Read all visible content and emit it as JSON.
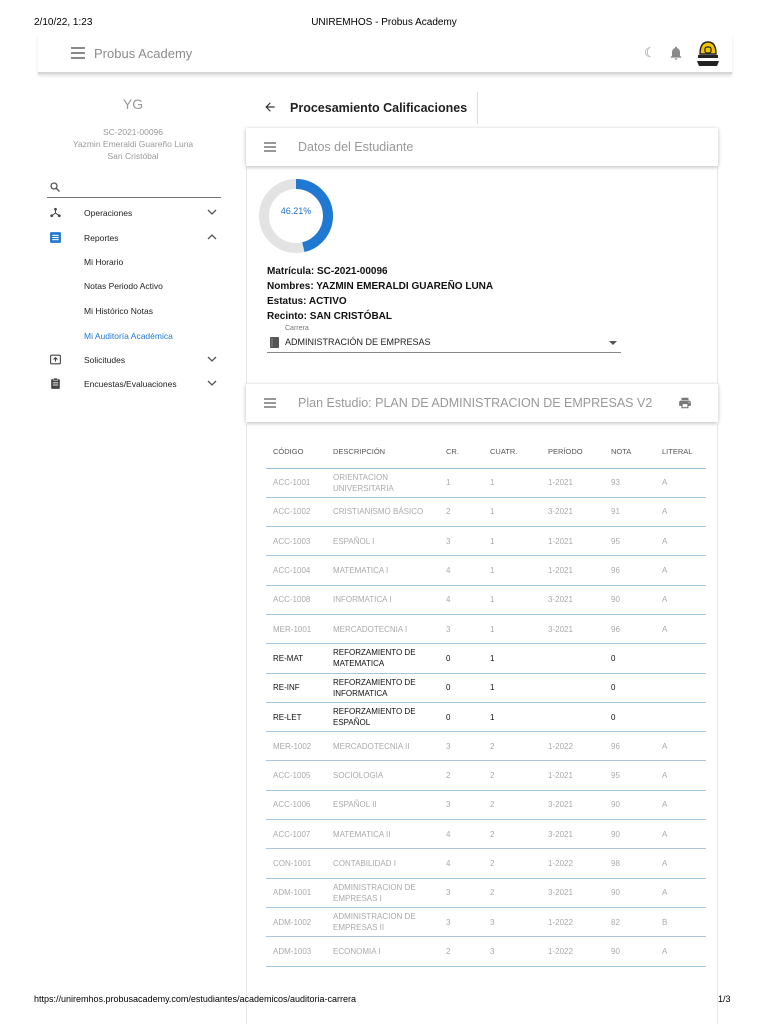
{
  "print": {
    "date": "2/10/22, 1:23",
    "window_title": "UNIREMHOS - Probus Academy",
    "url": "https://uniremhos.probusacademy.com/estudiantes/academicos/auditoria-carrera",
    "page": "1/3"
  },
  "topbar": {
    "brand": "Probus Academy",
    "moon_glyph": "☾"
  },
  "sidebar": {
    "initials": "YG",
    "student_id": "SC-2021-00096",
    "student_name": "Yazmin Emeraldi Guareño Luna",
    "campus": "San Cristóbal",
    "nav": [
      {
        "label": "Operaciones",
        "icon": "hub-icon"
      },
      {
        "label": "Reportes",
        "icon": "list-icon"
      },
      {
        "label": "Solicitudes",
        "icon": "upload-box-icon"
      },
      {
        "label": "Encuestas/Evaluaciones",
        "icon": "clipboard-icon"
      }
    ],
    "sub": [
      "Mi Horario",
      "Notas Periodo Activo",
      "Mi Histórico Notas",
      "Mi Auditoría Académica"
    ]
  },
  "main": {
    "breadcrumb_title": "Procesamiento Calificaciones",
    "student_card_title": "Datos del Estudiante",
    "progress_label": "46.21%",
    "progress_value": 0.4621,
    "accent_color": "#1f78d1",
    "matricula": "Matrícula: SC-2021-00096",
    "nombres": "Nombres: YAZMIN EMERALDI GUAREÑO LUNA",
    "estatus": "Estatus: ACTIVO",
    "recinto": "Recinto: SAN CRISTÓBAL",
    "carrera_label": "Carrera",
    "carrera_value": "ADMINISTRACIÓN DE EMPRESAS",
    "plan_title": "Plan Estudio: PLAN DE ADMINISTRACION DE EMPRESAS V2"
  },
  "table": {
    "headers": [
      "CÓDIGO",
      "DESCRIPCIÓN",
      "CR.",
      "CUATR.",
      "PERÍODO",
      "NOTA",
      "LITERAL"
    ],
    "rows": [
      {
        "codigo": "ACC-1001",
        "desc": "ORIENTACION UNIVERSITARIA",
        "cr": "1",
        "cuatr": "1",
        "periodo": "1-2021",
        "nota": "93",
        "literal": "A",
        "current": false
      },
      {
        "codigo": "ACC-1002",
        "desc": "CRISTIANISMO BÁSICO",
        "cr": "2",
        "cuatr": "1",
        "periodo": "3-2021",
        "nota": "91",
        "literal": "A",
        "current": false
      },
      {
        "codigo": "ACC-1003",
        "desc": "ESPAÑOL I",
        "cr": "3",
        "cuatr": "1",
        "periodo": "1-2021",
        "nota": "95",
        "literal": "A",
        "current": false
      },
      {
        "codigo": "ACC-1004",
        "desc": "MATEMATICA I",
        "cr": "4",
        "cuatr": "1",
        "periodo": "1-2021",
        "nota": "96",
        "literal": "A",
        "current": false
      },
      {
        "codigo": "ACC-1008",
        "desc": "INFORMATICA I",
        "cr": "4",
        "cuatr": "1",
        "periodo": "3-2021",
        "nota": "90",
        "literal": "A",
        "current": false
      },
      {
        "codigo": "MER-1001",
        "desc": "MERCADOTECNIA I",
        "cr": "3",
        "cuatr": "1",
        "periodo": "3-2021",
        "nota": "96",
        "literal": "A",
        "current": false
      },
      {
        "codigo": "RE-MAT",
        "desc": "REFORZAMIENTO DE MATEMATICA",
        "cr": "0",
        "cuatr": "1",
        "periodo": "",
        "nota": "0",
        "literal": "",
        "current": true
      },
      {
        "codigo": "RE-INF",
        "desc": "REFORZAMIENTO DE INFORMATICA",
        "cr": "0",
        "cuatr": "1",
        "periodo": "",
        "nota": "0",
        "literal": "",
        "current": true
      },
      {
        "codigo": "RE-LET",
        "desc": "REFORZAMIENTO DE ESPAÑOL",
        "cr": "0",
        "cuatr": "1",
        "periodo": "",
        "nota": "0",
        "literal": "",
        "current": true
      },
      {
        "codigo": "MER-1002",
        "desc": "MERCADOTECNIA II",
        "cr": "3",
        "cuatr": "2",
        "periodo": "1-2022",
        "nota": "96",
        "literal": "A",
        "current": false
      },
      {
        "codigo": "ACC-1005",
        "desc": "SOCIOLOGIA",
        "cr": "2",
        "cuatr": "2",
        "periodo": "1-2021",
        "nota": "95",
        "literal": "A",
        "current": false
      },
      {
        "codigo": "ACC-1006",
        "desc": "ESPAÑOL II",
        "cr": "3",
        "cuatr": "2",
        "periodo": "3-2021",
        "nota": "90",
        "literal": "A",
        "current": false
      },
      {
        "codigo": "ACC-1007",
        "desc": "MATEMATICA II",
        "cr": "4",
        "cuatr": "2",
        "periodo": "3-2021",
        "nota": "90",
        "literal": "A",
        "current": false
      },
      {
        "codigo": "CON-1001",
        "desc": "CONTABILIDAD I",
        "cr": "4",
        "cuatr": "2",
        "periodo": "1-2022",
        "nota": "98",
        "literal": "A",
        "current": false
      },
      {
        "codigo": "ADM-1001",
        "desc": "ADMINISTRACION DE EMPRESAS I",
        "cr": "3",
        "cuatr": "2",
        "periodo": "3-2021",
        "nota": "90",
        "literal": "A",
        "current": false
      },
      {
        "codigo": "ADM-1002",
        "desc": "ADMINISTRACION DE EMPRESAS II",
        "cr": "3",
        "cuatr": "3",
        "periodo": "1-2022",
        "nota": "82",
        "literal": "B",
        "current": false
      },
      {
        "codigo": "ADM-1003",
        "desc": "ECONOMIA I",
        "cr": "2",
        "cuatr": "3",
        "periodo": "1-2022",
        "nota": "90",
        "literal": "A",
        "current": false
      }
    ]
  }
}
